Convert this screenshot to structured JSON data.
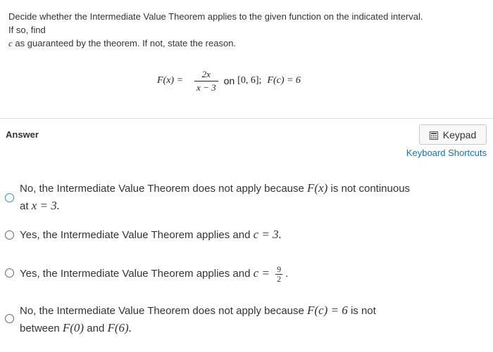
{
  "question": {
    "line1": "Decide whether the Intermediate Value Theorem applies to the given function on the indicated interval.",
    "line2": "If so, find",
    "line3_var": "c",
    "line3_rest": " as guaranteed by the theorem. If not, state the reason."
  },
  "equation": {
    "lhs": "F(x)  =",
    "numerator": "2x",
    "denominator": "x − 3",
    "on": "on",
    "interval": "[0, 6];",
    "condition": "F(c)  =  6"
  },
  "answer_label": "Answer",
  "keypad": {
    "label": "Keypad",
    "icon": "calculator-icon"
  },
  "shortcuts_label": "Keyboard Shortcuts",
  "options": [
    {
      "l1a": "No, the Intermediate Value Theorem does not apply because ",
      "l1b": "F(x)",
      "l1c": " is not continuous",
      "l2a": "at ",
      "l2b": "x  =  3."
    },
    {
      "a": "Yes, the Intermediate Value Theorem applies and ",
      "b": "c  =  3."
    },
    {
      "a": "Yes, the Intermediate Value Theorem applies and ",
      "b": "c  =",
      "num": "9",
      "den": "2",
      "c": "."
    },
    {
      "l1a": "No, the Intermediate Value Theorem does not apply because ",
      "l1b": "F(c)  =  6",
      "l1c": " is not",
      "l2a": "between ",
      "l2b": "F(0)",
      "l2c": " and ",
      "l2d": "F(6)."
    }
  ],
  "colors": {
    "accent": "#2d8ec9",
    "link": "#1b6fb0",
    "divider": "#dcdcdc"
  }
}
